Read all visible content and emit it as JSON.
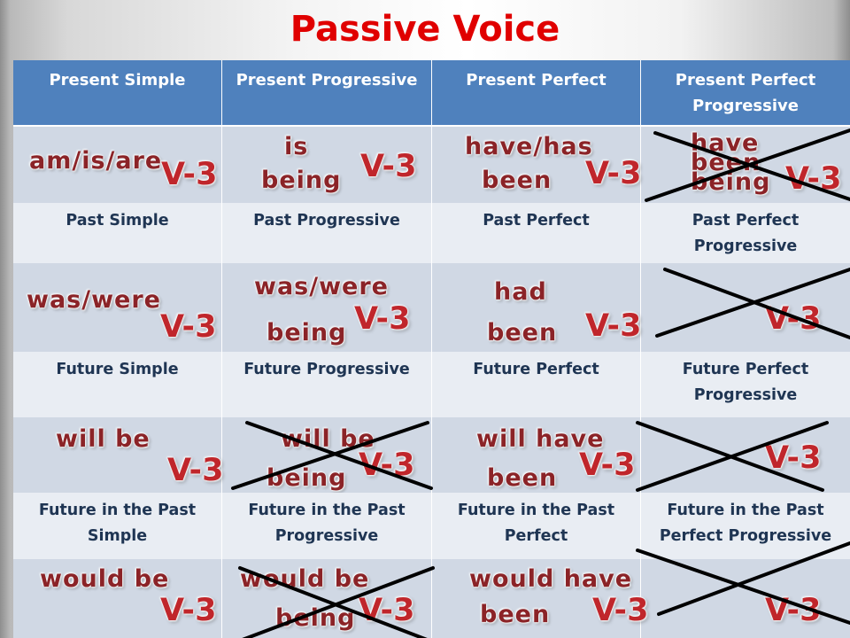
{
  "title": "Passive Voice",
  "colors": {
    "title": "#e00000",
    "header_bg": "#4f81bd",
    "form_row_bg": "#d0d8e4",
    "label_row_bg": "#e9edf3",
    "aux_text": "#8b2327",
    "v3_text": "#c0262b",
    "label_text": "#1f3553"
  },
  "headers": [
    {
      "line1": "Present Simple",
      "line2": ""
    },
    {
      "line1": "Present Progressive",
      "line2": ""
    },
    {
      "line1": "Present Perfect",
      "line2": ""
    },
    {
      "line1": "Present Perfect",
      "line2": "Progressive"
    }
  ],
  "rows": [
    {
      "forms": [
        {
          "aux1": "am/is/are",
          "aux2": "",
          "v3": "V-3",
          "crossed": false
        },
        {
          "aux1": "is",
          "aux2": "being",
          "v3": "V-3",
          "crossed": false
        },
        {
          "aux1": "have/has",
          "aux2": "been",
          "v3": "V-3",
          "crossed": false
        },
        {
          "aux1": "have",
          "aux2": "been",
          "aux3": "being",
          "v3": "V-3",
          "crossed": true
        }
      ],
      "labels": [
        {
          "line1": "Past Simple",
          "line2": ""
        },
        {
          "line1": "Past Progressive",
          "line2": ""
        },
        {
          "line1": "Past Perfect",
          "line2": ""
        },
        {
          "line1": "Past Perfect",
          "line2": "Progressive"
        }
      ]
    },
    {
      "forms": [
        {
          "aux1": "was/were",
          "aux2": "",
          "v3": "V-3",
          "crossed": false
        },
        {
          "aux1": "was/were",
          "aux2": "being",
          "v3": "V-3",
          "crossed": false
        },
        {
          "aux1": "had",
          "aux2": "been",
          "v3": "V-3",
          "crossed": false
        },
        {
          "aux1": "",
          "aux2": "",
          "v3": "V-3",
          "crossed": true
        }
      ],
      "labels": [
        {
          "line1": "Future Simple",
          "line2": ""
        },
        {
          "line1": "Future Progressive",
          "line2": ""
        },
        {
          "line1": "Future Perfect",
          "line2": ""
        },
        {
          "line1": "Future Perfect",
          "line2": "Progressive"
        }
      ]
    },
    {
      "forms": [
        {
          "aux1": "will be",
          "aux2": "",
          "v3": "V-3",
          "crossed": false
        },
        {
          "aux1": "will be",
          "aux2": "being",
          "v3": "V-3",
          "crossed": true
        },
        {
          "aux1": "will have",
          "aux2": "been",
          "v3": "V-3",
          "crossed": false
        },
        {
          "aux1": "",
          "aux2": "",
          "v3": "V-3",
          "crossed": true
        }
      ],
      "labels": [
        {
          "line1": "Future in the Past",
          "line2": "Simple"
        },
        {
          "line1": "Future in the Past",
          "line2": "Progressive"
        },
        {
          "line1": "Future in the Past",
          "line2": "Perfect"
        },
        {
          "line1": "Future in the Past",
          "line2": "Perfect Progressive"
        }
      ]
    },
    {
      "forms": [
        {
          "aux1": "would be",
          "aux2": "",
          "v3": "V-3",
          "crossed": false
        },
        {
          "aux1": "would be",
          "aux2": "being",
          "v3": "V-3",
          "crossed": true
        },
        {
          "aux1": "would have",
          "aux2": "been",
          "v3": "V-3",
          "crossed": false
        },
        {
          "aux1": "",
          "aux2": "",
          "v3": "V-3",
          "crossed": true
        }
      ]
    }
  ]
}
